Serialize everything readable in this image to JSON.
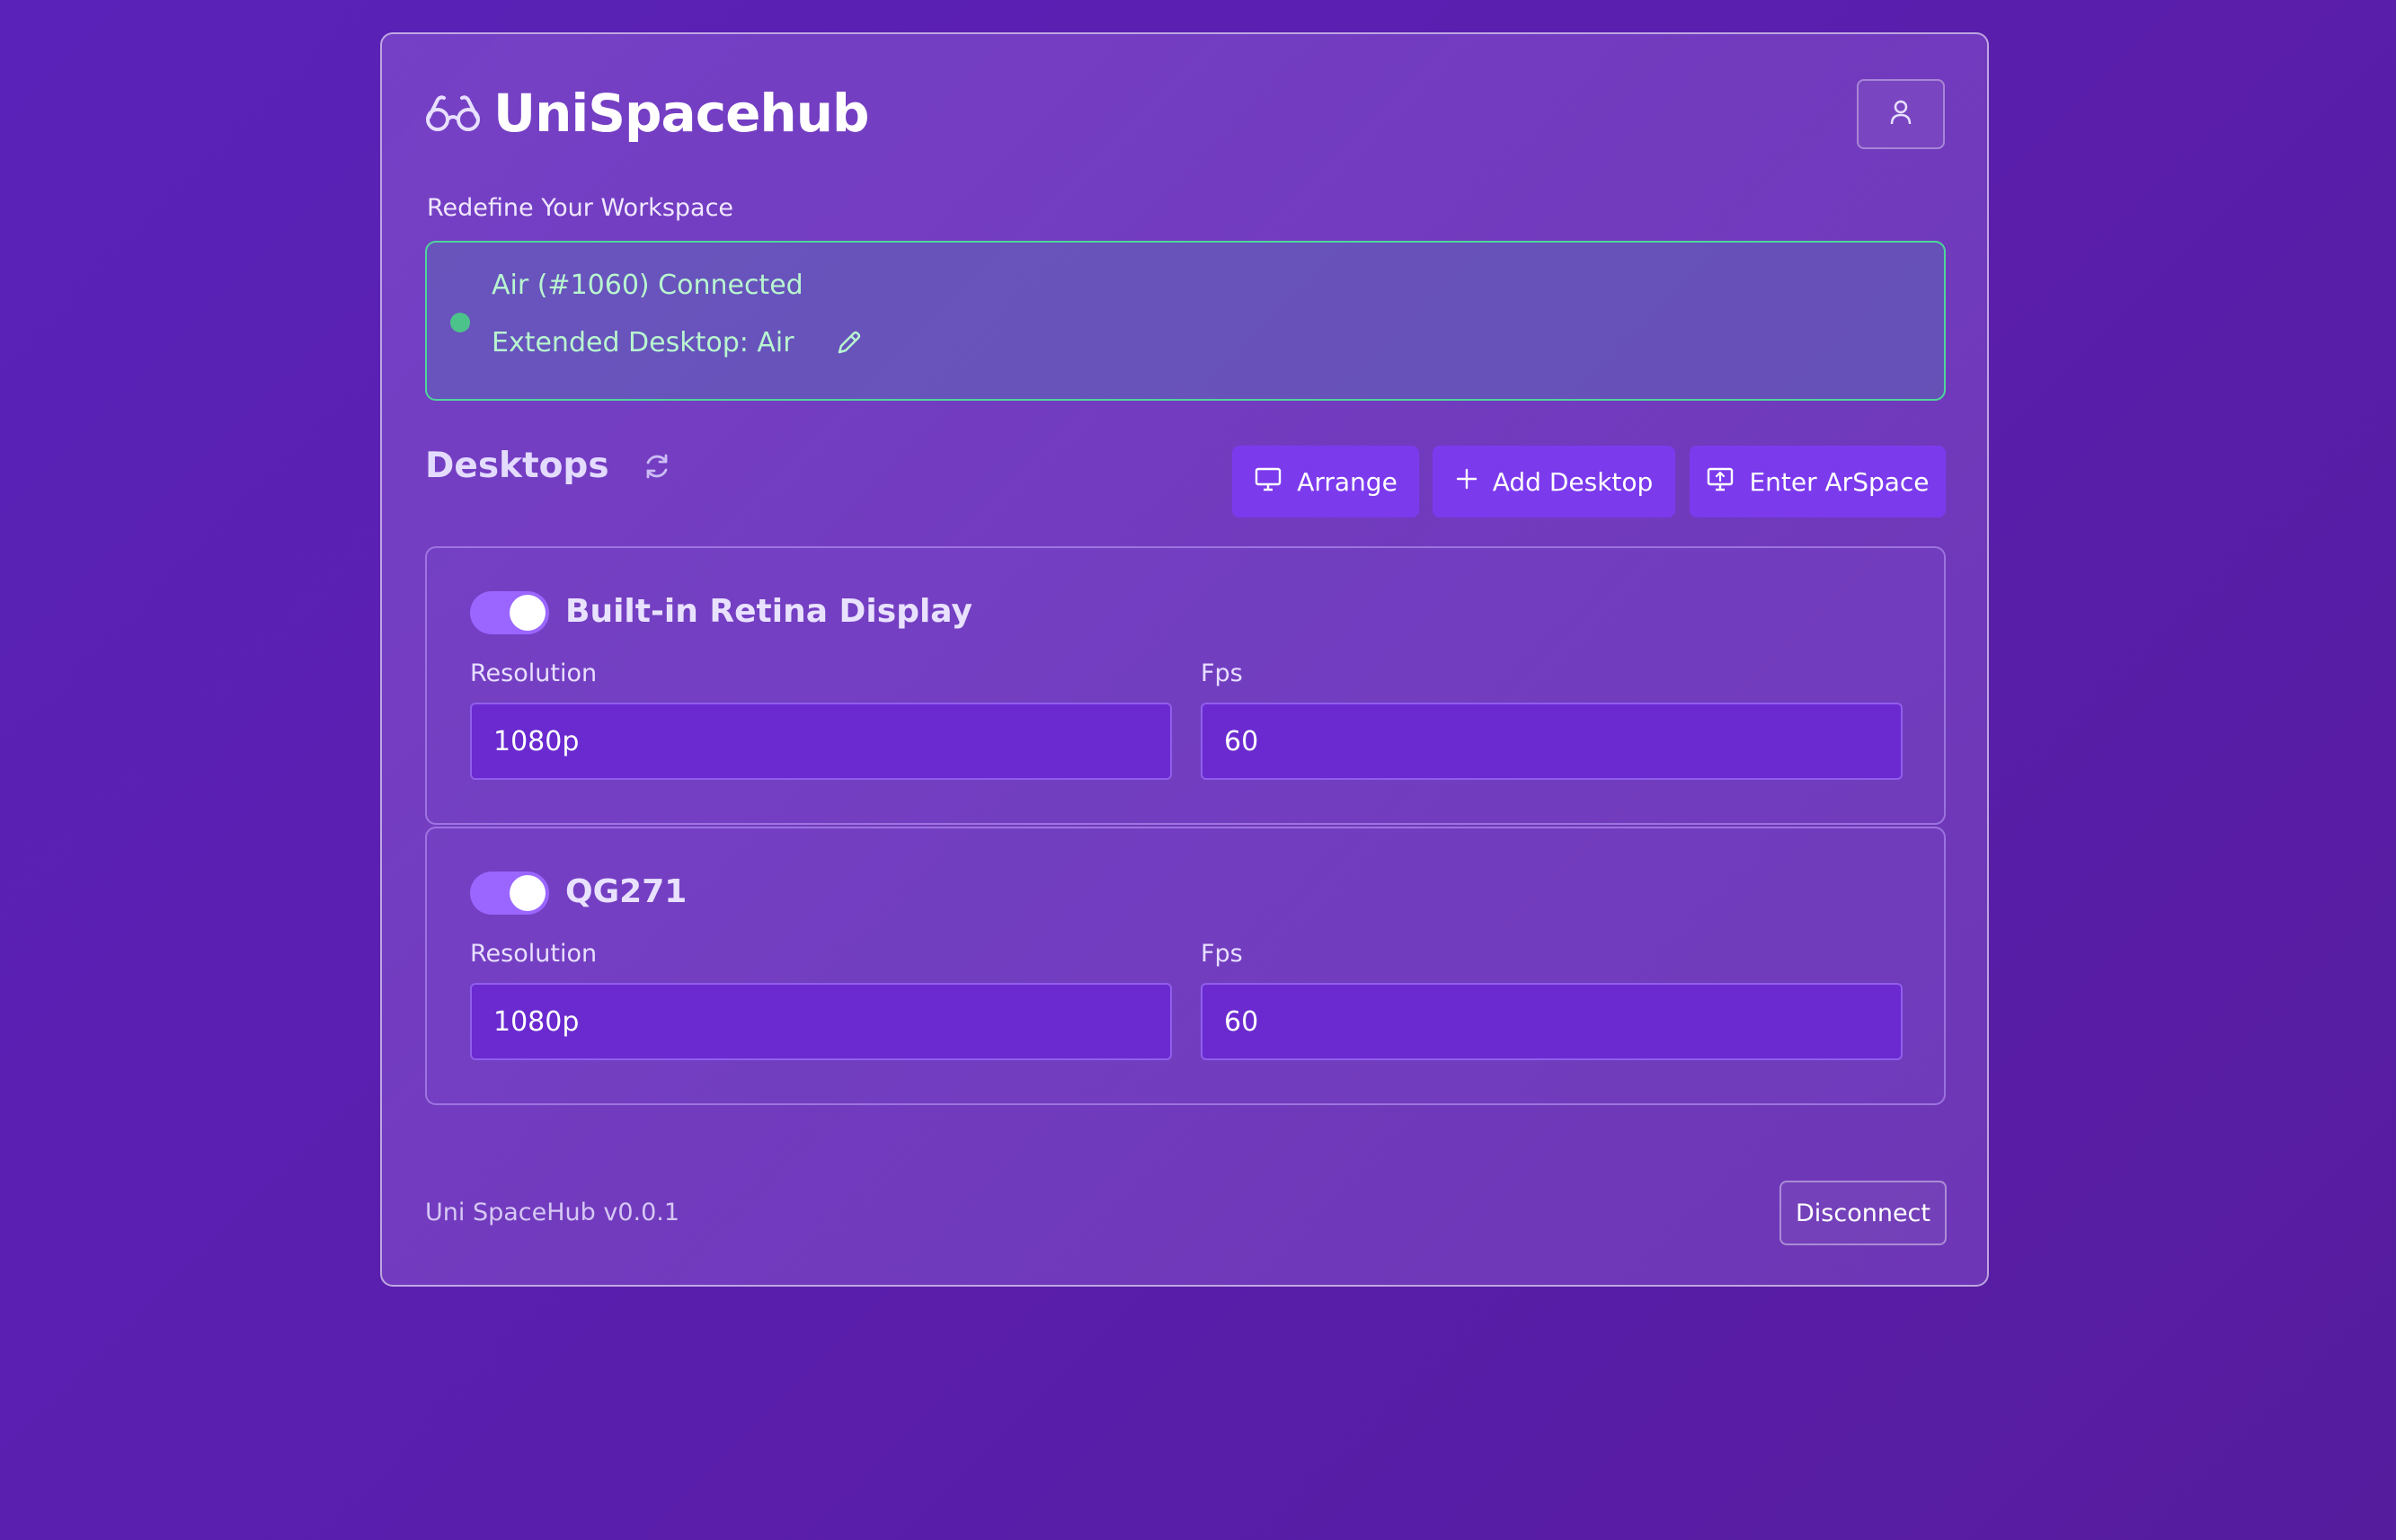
{
  "app": {
    "title": "UniSpacehub",
    "subtitle": "Redefine Your Workspace",
    "logo_icon": "glasses-icon"
  },
  "header": {
    "user_button_icon": "user-icon"
  },
  "status": {
    "connection_text": "Air (#1060) Connected",
    "desktop_text": "Extended Desktop: Air",
    "state": "connected",
    "color": "#4cc38a"
  },
  "desktops_section": {
    "title": "Desktops",
    "refresh_icon": "refresh-icon",
    "buttons": {
      "arrange": "Arrange",
      "add_desktop": "Add Desktop",
      "enter_arspace": "Enter ArSpace"
    }
  },
  "desktops": [
    {
      "name": "Built-in Retina Display",
      "enabled": true,
      "resolution_label": "Resolution",
      "resolution": "1080p",
      "fps_label": "Fps",
      "fps": "60"
    },
    {
      "name": "QG271",
      "enabled": true,
      "resolution_label": "Resolution",
      "resolution": "1080p",
      "fps_label": "Fps",
      "fps": "60"
    }
  ],
  "footer": {
    "version": "Uni SpaceHub v0.0.1",
    "disconnect": "Disconnect"
  },
  "colors": {
    "accent": "#7c3aed",
    "background": "#5a22b8",
    "connected_border": "#4ed69a"
  }
}
